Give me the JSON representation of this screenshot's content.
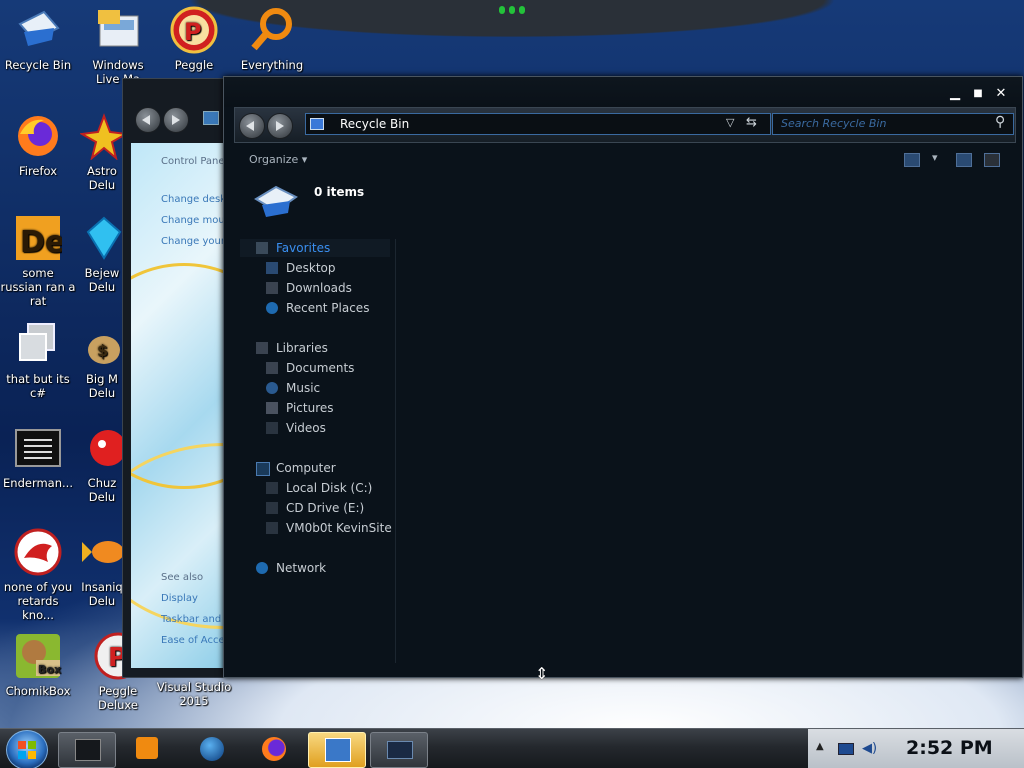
{
  "desktop": {
    "icons": [
      {
        "label": "Recycle Bin",
        "icon": "recycle-bin-icon"
      },
      {
        "label": "Windows Live Ma",
        "icon": "windows-live-mail-icon"
      },
      {
        "label": "Peggle",
        "icon": "peggle-icon"
      },
      {
        "label": "Everything",
        "icon": "search-magnifier-icon"
      },
      {
        "label": "Firefox",
        "icon": "firefox-icon"
      },
      {
        "label": "Astro Delu",
        "icon": "astro-icon"
      },
      {
        "label": "some russian ran a rat",
        "icon": "de-app-icon"
      },
      {
        "label": "Bejew Delu",
        "icon": "gem-icon"
      },
      {
        "label": "that but its c#",
        "icon": "windows-copy-icon"
      },
      {
        "label": "Big M Delu",
        "icon": "money-bag-icon"
      },
      {
        "label": "Enderman...",
        "icon": "terminal-icon"
      },
      {
        "label": "Chuz Delu",
        "icon": "red-ball-icon"
      },
      {
        "label": "none of you retards kno...",
        "icon": "red-dragon-icon"
      },
      {
        "label": "Insaniq Delu",
        "icon": "fish-icon"
      },
      {
        "label": "ChomikBox",
        "icon": "hamster-box-icon"
      },
      {
        "label": "Peggle Deluxe",
        "icon": "peggle-deluxe-icon"
      },
      {
        "label": "Visual Studio 2015",
        "icon": "visual-studio-icon"
      }
    ]
  },
  "bg_window": {
    "title": "Control Panel",
    "links": [
      "Control Pane",
      "Change deskt",
      "Change mou",
      "Change your"
    ],
    "see_also": "See also",
    "see_also_links": [
      "Display",
      "Taskbar and",
      "Ease of Acce"
    ]
  },
  "main_window": {
    "controls": {
      "minimize": "▁",
      "maximize": "■",
      "close": "✕"
    },
    "address": "Recycle Bin",
    "search_placeholder": "Search Recycle Bin",
    "organize": "Organize",
    "items_count": "0 items",
    "nav": {
      "favorites": "Favorites",
      "favorites_items": [
        "Desktop",
        "Downloads",
        "Recent Places"
      ],
      "libraries": "Libraries",
      "libraries_items": [
        "Documents",
        "Music",
        "Pictures",
        "Videos"
      ],
      "computer": "Computer",
      "computer_items": [
        "Local Disk (C:)",
        "CD Drive (E:)",
        "VM0b0t KevinSite"
      ],
      "network": "Network"
    }
  },
  "taskbar": {
    "pinned": [
      "explorer-icon",
      "media-player-icon",
      "globe-icon",
      "firefox-icon",
      "visual-studio-icon",
      "explorer-window-icon"
    ],
    "clock": "2:52 PM"
  },
  "colors": {
    "accent": "#3a8ff0",
    "window_bg": "#0a121a",
    "taskbar_bg": "#24282d"
  }
}
